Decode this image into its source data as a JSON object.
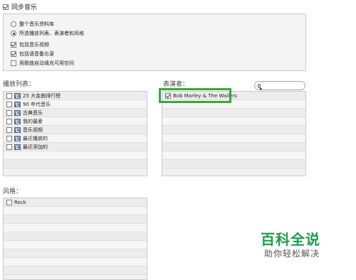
{
  "sync": {
    "label": "同步音乐",
    "checked": true
  },
  "options": {
    "radios": [
      {
        "label": "整个音乐资料库",
        "selected": false
      },
      {
        "label": "所选播放列表、表演者和风格",
        "selected": true
      }
    ],
    "checkboxes": [
      {
        "label": "包括音乐视频",
        "checked": true
      },
      {
        "label": "包括语音备忘录",
        "checked": true
      },
      {
        "label": "用歌曲自动填充可用空间",
        "checked": false
      }
    ]
  },
  "playlists": {
    "label": "播放列表：",
    "items": [
      {
        "label": "25 大金曲排行榜",
        "checked": false
      },
      {
        "label": "90 年代音乐",
        "checked": false
      },
      {
        "label": "古典音乐",
        "checked": false
      },
      {
        "label": "我的最爱",
        "checked": false
      },
      {
        "label": "音乐视频",
        "checked": false
      },
      {
        "label": "最近播放的",
        "checked": false
      },
      {
        "label": "最近添加的",
        "checked": false
      }
    ]
  },
  "artists": {
    "label": "表演者：",
    "search_placeholder": "",
    "items": [
      {
        "label": "Bob Marley & The Wailers",
        "checked": true
      }
    ],
    "highlight_color": "#3aa83a"
  },
  "genres": {
    "label": "风格：",
    "items": [
      {
        "label": "Rock",
        "checked": false
      }
    ]
  },
  "watermark": {
    "main": "百科全说",
    "sub": "助你轻松解决"
  }
}
